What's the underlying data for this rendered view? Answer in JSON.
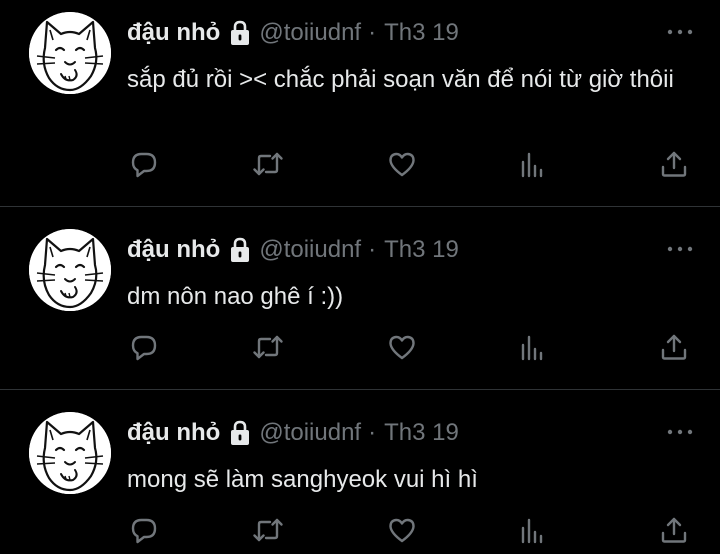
{
  "tweets": [
    {
      "name": "đậu nhỏ",
      "handle": "@toiiudnf",
      "separator": "·",
      "date": "Th3 19",
      "text": "sắp đủ rồi >< chắc phải soạn văn để nói từ giờ thôii"
    },
    {
      "name": "đậu nhỏ",
      "handle": "@toiiudnf",
      "separator": "·",
      "date": "Th3 19",
      "text": "dm nôn nao ghê í :))"
    },
    {
      "name": "đậu nhỏ",
      "handle": "@toiiudnf",
      "separator": "·",
      "date": "Th3 19",
      "text": "mong sẽ làm sanghyeok vui hì hì"
    }
  ],
  "icons": {
    "reply": "reply-icon",
    "retweet": "retweet-icon",
    "like": "like-icon",
    "views": "views-icon",
    "share": "share-icon",
    "lock": "lock-icon",
    "more": "more-icon"
  },
  "colors": {
    "background": "#000000",
    "text": "#e7e9ea",
    "secondary": "#71767b",
    "divider": "#2f3336"
  }
}
